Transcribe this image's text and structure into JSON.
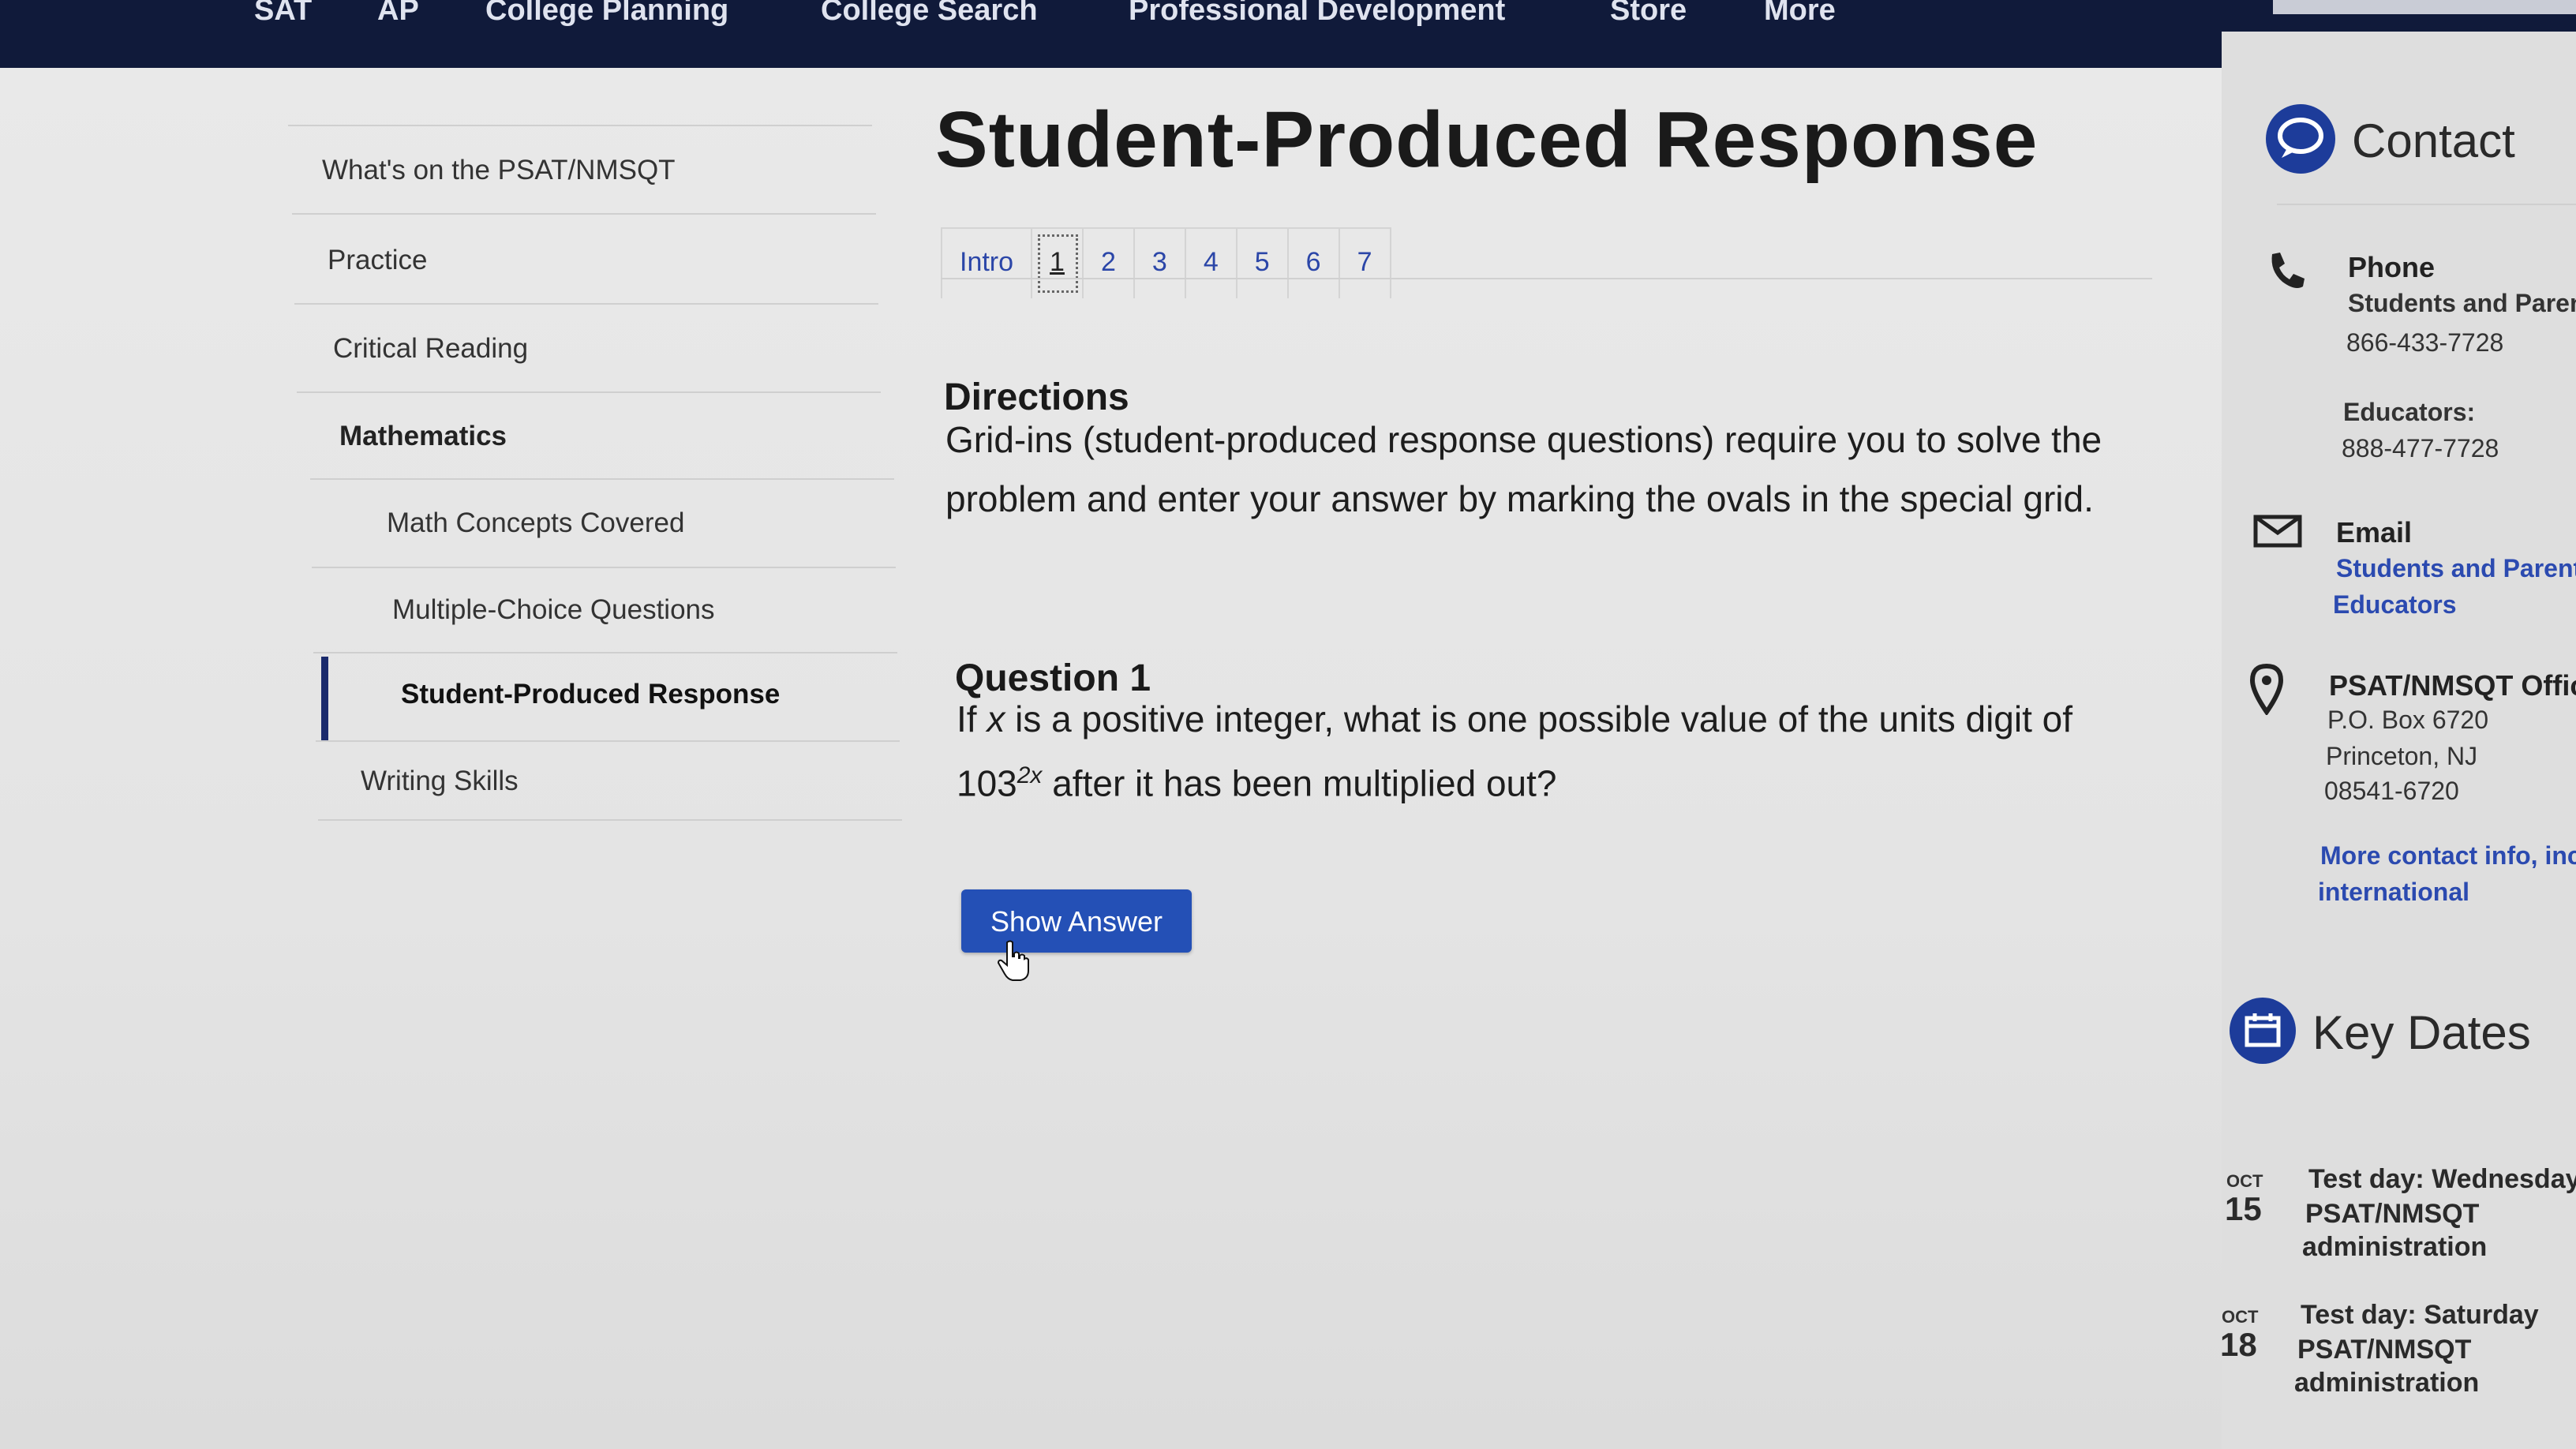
{
  "topnav": {
    "items": [
      "SAT",
      "AP",
      "College Planning",
      "College Search",
      "Professional Development",
      "Store",
      "More"
    ]
  },
  "leftnav": {
    "items": [
      {
        "label": "What's on the PSAT/NMSQT"
      },
      {
        "label": "Practice"
      },
      {
        "label": "Critical Reading"
      },
      {
        "label": "Mathematics"
      },
      {
        "label": "Math Concepts Covered"
      },
      {
        "label": "Multiple-Choice Questions"
      },
      {
        "label": "Student-Produced Response",
        "active": true
      },
      {
        "label": "Writing Skills"
      }
    ]
  },
  "main": {
    "title": "Student-Produced Response",
    "tabs": [
      "Intro",
      "1",
      "2",
      "3",
      "4",
      "5",
      "6",
      "7"
    ],
    "current_tab": "1",
    "directions_heading": "Directions",
    "directions_text": "Grid-ins (student-produced response questions) require you to solve the problem and enter your answer by marking the ovals in the special grid.",
    "question_heading": "Question 1",
    "question_pre": "If ",
    "question_var": "x",
    "question_mid": " is a positive integer, what is one possible value of the units digit of ",
    "question_base": "103",
    "question_exp": "2x",
    "question_post": " after it has been multiplied out?",
    "show_answer_label": "Show Answer"
  },
  "sidebar": {
    "contact_heading": "Contact",
    "phone_label": "Phone",
    "phone_students_label": "Students and Parents:",
    "phone_students": "866-433-7728",
    "phone_educators_label": "Educators:",
    "phone_educators": "888-477-7728",
    "email_label": "Email",
    "email_students_link": "Students and Parents",
    "email_educators_link": "Educators",
    "office_label": "PSAT/NMSQT Office",
    "office_line1": "P.O. Box 6720",
    "office_line2": "Princeton, NJ",
    "office_line3": "08541-6720",
    "more_link_line1": "More contact info, including",
    "more_link_line2": "international",
    "keydates_heading": "Key Dates",
    "dates": [
      {
        "month": "OCT",
        "day": "15",
        "line1": "Test day: Wednesday",
        "line2": "PSAT/NMSQT",
        "line3": "administration"
      },
      {
        "month": "OCT",
        "day": "18",
        "line1": "Test day: Saturday",
        "line2": "PSAT/NMSQT",
        "line3": "administration"
      }
    ]
  },
  "colors": {
    "nav_bg": "#101a3a",
    "accent": "#2450b6",
    "link": "#2b46a8"
  },
  "icons": [
    "phone-icon",
    "email-icon",
    "location-pin-icon",
    "chat-bubble-icon",
    "calendar-icon",
    "hand-cursor-icon"
  ]
}
